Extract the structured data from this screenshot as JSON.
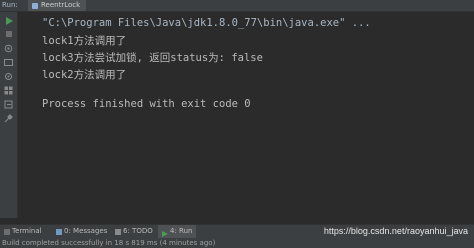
{
  "topbar": {
    "run_label": "Run:",
    "tab_label": "ReentrLock"
  },
  "console": {
    "lines": [
      "\"C:\\Program Files\\Java\\jdk1.8.0_77\\bin\\java.exe\" ...",
      "lock1方法调用了",
      "lock3方法尝试加锁, 返回status为: false",
      "lock2方法调用了",
      "",
      "Process finished with exit code 0"
    ]
  },
  "bottom_tabs": [
    {
      "label": "Terminal",
      "icon": "terminal-icon"
    },
    {
      "label": "0: Messages",
      "icon": "messages-icon"
    },
    {
      "label": "6: TODO",
      "icon": "todo-icon"
    },
    {
      "label": "4: Run",
      "icon": "run-icon"
    }
  ],
  "status": {
    "message": "Build completed successfully in 18 s 819 ms (4 minutes ago)"
  },
  "watermark": "https://blog.csdn.net/raoyanhui_java",
  "colors": {
    "background": "#2b2b2b",
    "panel": "#3c3f41",
    "run_green": "#499c54"
  }
}
